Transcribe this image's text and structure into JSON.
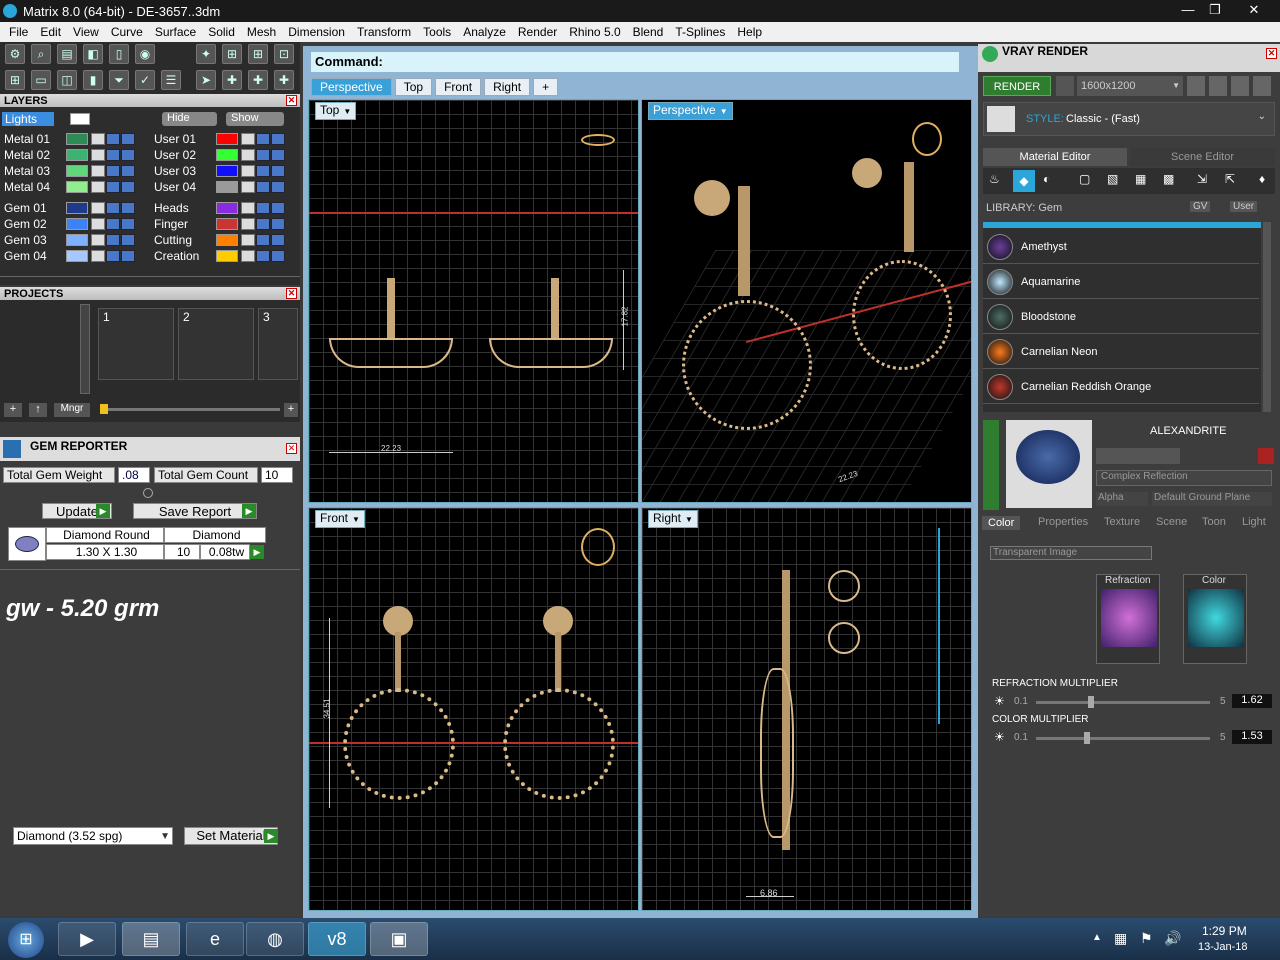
{
  "window": {
    "title": "Matrix 8.0 (64-bit) - DE-3657..3dm",
    "min": "—",
    "max": "❐",
    "close": "✕"
  },
  "menu": [
    "File",
    "Edit",
    "View",
    "Curve",
    "Surface",
    "Solid",
    "Mesh",
    "Dimension",
    "Transform",
    "Tools",
    "Analyze",
    "Render",
    "Rhino 5.0",
    "Blend",
    "T-Splines",
    "Help"
  ],
  "layers": {
    "title": "LAYERS",
    "lights": "Lights",
    "hide": "Hide",
    "show": "Show",
    "left": [
      {
        "name": "Metal 01",
        "color": "#2e8b57"
      },
      {
        "name": "Metal 02",
        "color": "#3cb371"
      },
      {
        "name": "Metal 03",
        "color": "#5fd77a"
      },
      {
        "name": "Metal 04",
        "color": "#90ee90"
      },
      {
        "name": "Gem 01",
        "color": "#1e3a8a"
      },
      {
        "name": "Gem 02",
        "color": "#3b82f6"
      },
      {
        "name": "Gem 03",
        "color": "#7fb0ff"
      },
      {
        "name": "Gem 04",
        "color": "#a6c8ff"
      }
    ],
    "right": [
      {
        "name": "User 01",
        "color": "#ff0000"
      },
      {
        "name": "User 02",
        "color": "#33ff33"
      },
      {
        "name": "User 03",
        "color": "#1010ff"
      },
      {
        "name": "User 04",
        "color": "#9a9a9a"
      },
      {
        "name": "Heads",
        "color": "#8a2be2"
      },
      {
        "name": "Finger",
        "color": "#cc3333"
      },
      {
        "name": "Cutting",
        "color": "#ff7f00"
      },
      {
        "name": "Creation",
        "color": "#ffcc00"
      }
    ]
  },
  "projects": {
    "title": "PROJECTS",
    "slots": [
      "1",
      "2",
      "3"
    ],
    "mngr": "Mngr"
  },
  "gem_reporter": {
    "title": "GEM REPORTER",
    "weight_label": "Total Gem Weight",
    "weight_value": ".08",
    "count_label": "Total Gem Count",
    "count_value": "10",
    "update": "Update",
    "save": "Save Report",
    "col1_header": "Diamond Round",
    "col2_header": "Diamond",
    "size": "1.30 X 1.30",
    "qty": "10",
    "tw": "0.08tw",
    "note": "gw - 5.20 grm",
    "material_select": "Diamond    (3.52 spg)",
    "set_material": "Set Material"
  },
  "viewport_area": {
    "command": "Command:",
    "tabs": [
      "Perspective",
      "Top",
      "Front",
      "Right",
      "+"
    ],
    "views": {
      "top": "Top",
      "perspective": "Perspective",
      "front": "Front",
      "right": "Right"
    },
    "dims": {
      "top_w": "22.23",
      "top_h": "17.82",
      "persp": "22.23",
      "front_h": "34.51",
      "right_w": "6.86"
    }
  },
  "vray": {
    "title": "VRAY RENDER",
    "render": "RENDER",
    "resolution": "1600x1200",
    "style_label": "STYLE:",
    "style_value": "Classic - (Fast)",
    "tab_material": "Material Editor",
    "tab_scene": "Scene Editor",
    "library": "LIBRARY: Gem",
    "gv": "GV",
    "user": "User",
    "materials": [
      {
        "name": "Amethyst",
        "color": "#6a3fa0"
      },
      {
        "name": "Aquamarine",
        "color": "#bfe9ff"
      },
      {
        "name": "Bloodstone",
        "color": "#4d6e66"
      },
      {
        "name": "Carnelian Neon",
        "color": "#ff7a1a"
      },
      {
        "name": "Carnelian Reddish Orange",
        "color": "#c0392b"
      }
    ],
    "selected": "ALEXANDRITE",
    "reflection": "Complex Reflection",
    "alpha": "Alpha",
    "ground": "Default Ground Plane",
    "subtabs": [
      "Color",
      "Properties",
      "Texture",
      "Scene",
      "Toon",
      "Light"
    ],
    "transparent": "Transparent Image",
    "refraction": "Refraction",
    "color": "Color",
    "refr_mult": "REFRACTION MULTIPLIER",
    "refr_min": "0.1",
    "refr_max": "5",
    "refr_val": "1.62",
    "col_mult": "COLOR MULTIPLIER",
    "col_min": "0.1",
    "col_max": "5",
    "col_val": "1.53"
  },
  "taskbar": {
    "time": "1:29 PM",
    "date": "13-Jan-18"
  }
}
